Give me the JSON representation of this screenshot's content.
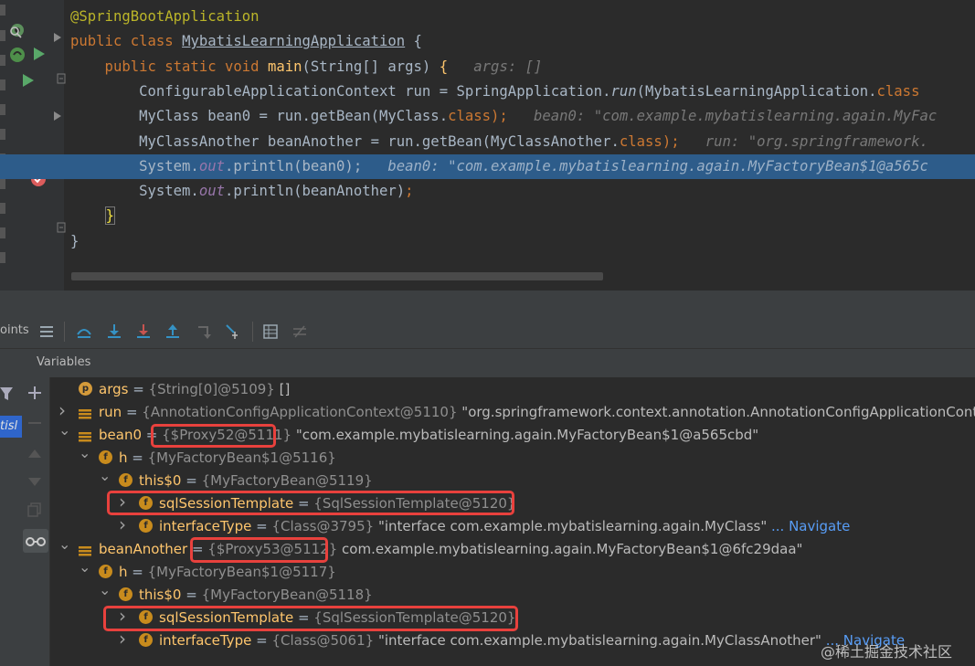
{
  "editor": {
    "lines": [
      {
        "segments": [
          {
            "t": "@SpringBootApplication",
            "c": "ann"
          }
        ]
      },
      {
        "segments": [
          {
            "t": "public class ",
            "c": "kw"
          },
          {
            "t": "MybatisLearningApplication",
            "c": "ul"
          },
          {
            "t": " {",
            "c": ""
          }
        ]
      },
      {
        "segments": [
          {
            "t": "    public static void ",
            "c": "kw"
          },
          {
            "t": "main",
            "c": "fn"
          },
          {
            "t": "(String[] args) ",
            "c": ""
          },
          {
            "t": "{",
            "c": "brace-yellow"
          },
          {
            "t": "   args: []",
            "c": "hint"
          }
        ]
      },
      {
        "segments": [
          {
            "t": "        ConfigurableApplicationContext run = SpringApplication.",
            "c": ""
          },
          {
            "t": "run",
            "c": "it"
          },
          {
            "t": "(MybatisLearningApplication.",
            "c": ""
          },
          {
            "t": "class",
            "c": "kw"
          }
        ]
      },
      {
        "segments": [
          {
            "t": "        MyClass bean0 = run.getBean(MyClass.",
            "c": ""
          },
          {
            "t": "class",
            "c": "kw"
          },
          {
            "t": ");",
            "c": "kw"
          },
          {
            "t": "   bean0: \"com.example.mybatislearning.again.MyFac",
            "c": "hint"
          }
        ]
      },
      {
        "segments": [
          {
            "t": "        MyClassAnother beanAnother = run.getBean(MyClassAnother.",
            "c": ""
          },
          {
            "t": "class",
            "c": "kw"
          },
          {
            "t": ");",
            "c": "kw"
          },
          {
            "t": "   run: \"org.springframework.",
            "c": "hint"
          }
        ]
      },
      {
        "segments": [
          {
            "t": "        System.",
            "c": ""
          },
          {
            "t": "out",
            "c": "fld"
          },
          {
            "t": ".println(bean0);",
            "c": ""
          },
          {
            "t": "   bean0: \"com.example.mybatislearning.again.MyFactoryBean$1@a565c",
            "c": "hlhint"
          }
        ],
        "highlight": true
      },
      {
        "segments": [
          {
            "t": "        System.",
            "c": ""
          },
          {
            "t": "out",
            "c": "fld"
          },
          {
            "t": ".println(beanAnother)",
            "c": ""
          },
          {
            "t": ";",
            "c": "kw"
          }
        ]
      },
      {
        "segments": [
          {
            "t": "    ",
            "c": ""
          },
          {
            "t": "}",
            "c": "brace"
          }
        ]
      },
      {
        "segments": [
          {
            "t": "}",
            "c": ""
          }
        ]
      }
    ]
  },
  "toolbar": {
    "left_label": "oints",
    "icons": [
      "threads-list-icon",
      "step-over-icon",
      "step-into-icon",
      "force-step-into-icon",
      "step-out-icon",
      "drop-frame-icon",
      "run-to-cursor-icon",
      "evaluate-icon",
      "trace-icon"
    ]
  },
  "variables": {
    "header": "Variables",
    "side_tab": "tisl",
    "rows": [
      {
        "indent": 0,
        "arrow": "",
        "icon": "p",
        "name": "args",
        "type": "{String[0]@5109}",
        "value": " []",
        "nav": ""
      },
      {
        "indent": 0,
        "arrow": ">",
        "icon": "lines",
        "name": "run",
        "type": "{AnnotationConfigApplicationContext@5110}",
        "value": " \"org.springframework.context.annotation.AnnotationConfigApplicationContext",
        "nav": ""
      },
      {
        "indent": 0,
        "arrow": "v",
        "icon": "lines",
        "name": "bean0",
        "type": "{$Proxy52@5111}",
        "value": " \"com.example.mybatislearning.again.MyFactoryBean$1@a565cbd\"",
        "nav": ""
      },
      {
        "indent": 1,
        "arrow": "v",
        "icon": "f",
        "name": "h",
        "type": "{MyFactoryBean$1@5116}",
        "value": "",
        "nav": ""
      },
      {
        "indent": 2,
        "arrow": "v",
        "icon": "f-lock",
        "name": "this$0",
        "type": "{MyFactoryBean@5119}",
        "value": "",
        "nav": ""
      },
      {
        "indent": 3,
        "arrow": ">",
        "icon": "f",
        "name": "sqlSessionTemplate",
        "type": "{SqlSessionTemplate@5120}",
        "value": "",
        "nav": ""
      },
      {
        "indent": 3,
        "arrow": ">",
        "icon": "f",
        "name": "interfaceType",
        "type": "{Class@3795}",
        "value": " \"interface com.example.mybatislearning.again.MyClass\"",
        "nav": " ... Navigate"
      },
      {
        "indent": 0,
        "arrow": "v",
        "icon": "lines",
        "name": "beanAnother",
        "type": "{$Proxy53@5112}",
        "value": " com.example.mybatislearning.again.MyFactoryBean$1@6fc29daa\"",
        "nav": ""
      },
      {
        "indent": 1,
        "arrow": "v",
        "icon": "f",
        "name": "h",
        "type": "{MyFactoryBean$1@5117}",
        "value": "",
        "nav": ""
      },
      {
        "indent": 2,
        "arrow": "v",
        "icon": "f-lock",
        "name": "this$0",
        "type": "{MyFactoryBean@5118}",
        "value": "",
        "nav": ""
      },
      {
        "indent": 3,
        "arrow": ">",
        "icon": "f",
        "name": "sqlSessionTemplate",
        "type": "{SqlSessionTemplate@5120}",
        "value": "",
        "nav": ""
      },
      {
        "indent": 3,
        "arrow": ">",
        "icon": "f",
        "name": "interfaceType",
        "type": "{Class@5061}",
        "value": " \"interface com.example.mybatislearning.again.MyClassAnother\"",
        "nav": " ... Navigate"
      }
    ]
  },
  "watermark": "@稀土掘金技术社区",
  "colors": {
    "highlight": "#2d5c8a",
    "annotation_box": "#e8413d"
  }
}
